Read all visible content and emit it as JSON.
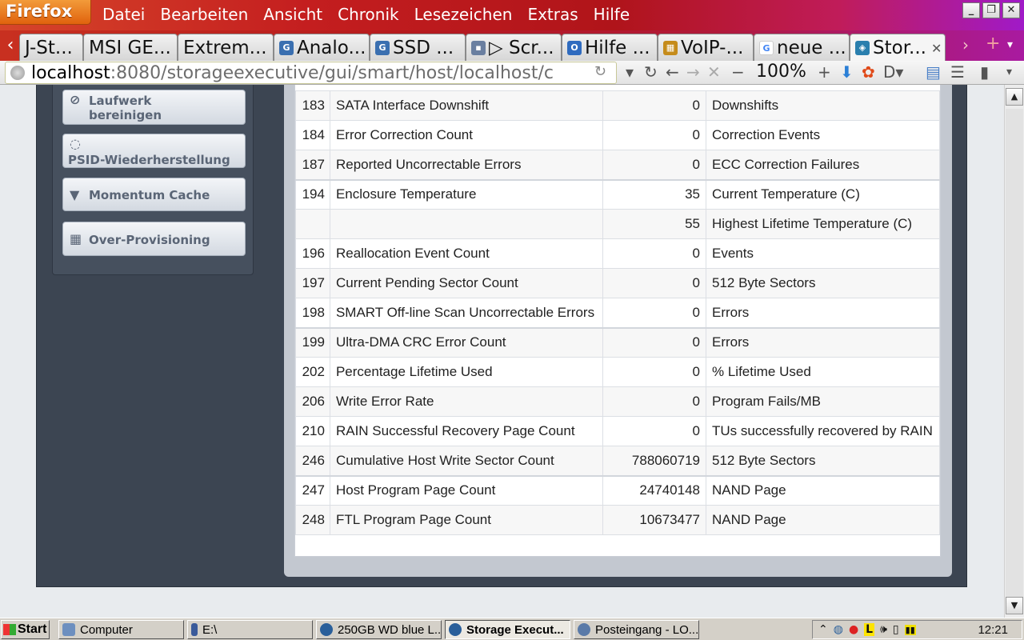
{
  "browser": {
    "app_button": "Firefox",
    "menu": [
      "Datei",
      "Bearbeiten",
      "Ansicht",
      "Chronik",
      "Lesezeichen",
      "Extras",
      "Hilfe"
    ],
    "tabs": [
      {
        "label": "J-St..."
      },
      {
        "label": "MSI GE..."
      },
      {
        "label": "Extrem..."
      },
      {
        "label": "Analo..."
      },
      {
        "label": "SSD ..."
      },
      {
        "label": "▷ Scr..."
      },
      {
        "label": "Hilfe ..."
      },
      {
        "label": "VoIP-..."
      },
      {
        "label": "neue ..."
      },
      {
        "label": "Stor...",
        "active": true
      }
    ],
    "url_host": "localhost",
    "url_rest": ":8080/storageexecutive/gui/smart/host/localhost/c",
    "zoom": "100%"
  },
  "sidebar": {
    "buttons": [
      {
        "label": "Laufwerk bereinigen",
        "icon": "forbidden-icon"
      },
      {
        "label": "PSID-Wiederherstellung",
        "icon": "eye-slash-icon"
      },
      {
        "label": "Momentum Cache",
        "icon": "filter-icon"
      },
      {
        "label": "Over-Provisioning",
        "icon": "grid-icon"
      }
    ]
  },
  "smart": {
    "rows": [
      {
        "id": "183",
        "name": "SATA Interface Downshift",
        "value": "0",
        "unit": "Downshifts"
      },
      {
        "id": "184",
        "name": "Error Correction Count",
        "value": "0",
        "unit": "Correction Events"
      },
      {
        "id": "187",
        "name": "Reported Uncorrectable Errors",
        "value": "0",
        "unit": "ECC Correction Failures"
      },
      {
        "id": "194",
        "name": "Enclosure Temperature",
        "value": "35",
        "unit": "Current Temperature (C)"
      },
      {
        "id": "",
        "name": "",
        "value": "55",
        "unit": "Highest Lifetime Temperature (C)"
      },
      {
        "id": "196",
        "name": "Reallocation Event Count",
        "value": "0",
        "unit": "Events"
      },
      {
        "id": "197",
        "name": "Current Pending Sector Count",
        "value": "0",
        "unit": "512 Byte Sectors"
      },
      {
        "id": "198",
        "name": "SMART Off-line Scan Uncorrectable Errors",
        "value": "0",
        "unit": "Errors"
      },
      {
        "id": "199",
        "name": "Ultra-DMA CRC Error Count",
        "value": "0",
        "unit": "Errors"
      },
      {
        "id": "202",
        "name": "Percentage Lifetime Used",
        "value": "0",
        "unit": "% Lifetime Used"
      },
      {
        "id": "206",
        "name": "Write Error Rate",
        "value": "0",
        "unit": "Program Fails/MB"
      },
      {
        "id": "210",
        "name": "RAIN Successful Recovery Page Count",
        "value": "0",
        "unit": "TUs successfully recovered by RAIN"
      },
      {
        "id": "246",
        "name": "Cumulative Host Write Sector Count",
        "value": "788060719",
        "unit": "512 Byte Sectors"
      },
      {
        "id": "247",
        "name": "Host Program Page Count",
        "value": "24740148",
        "unit": "NAND Page"
      },
      {
        "id": "248",
        "name": "FTL Program Page Count",
        "value": "10673477",
        "unit": "NAND Page"
      }
    ]
  },
  "taskbar": {
    "start": "Start",
    "tasks": [
      {
        "label": "Computer"
      },
      {
        "label": "E:\\"
      },
      {
        "label": "250GB WD blue L..."
      },
      {
        "label": "Storage Execut...",
        "active": true
      },
      {
        "label": "Posteingang - LO..."
      }
    ],
    "clock": "12:21"
  }
}
